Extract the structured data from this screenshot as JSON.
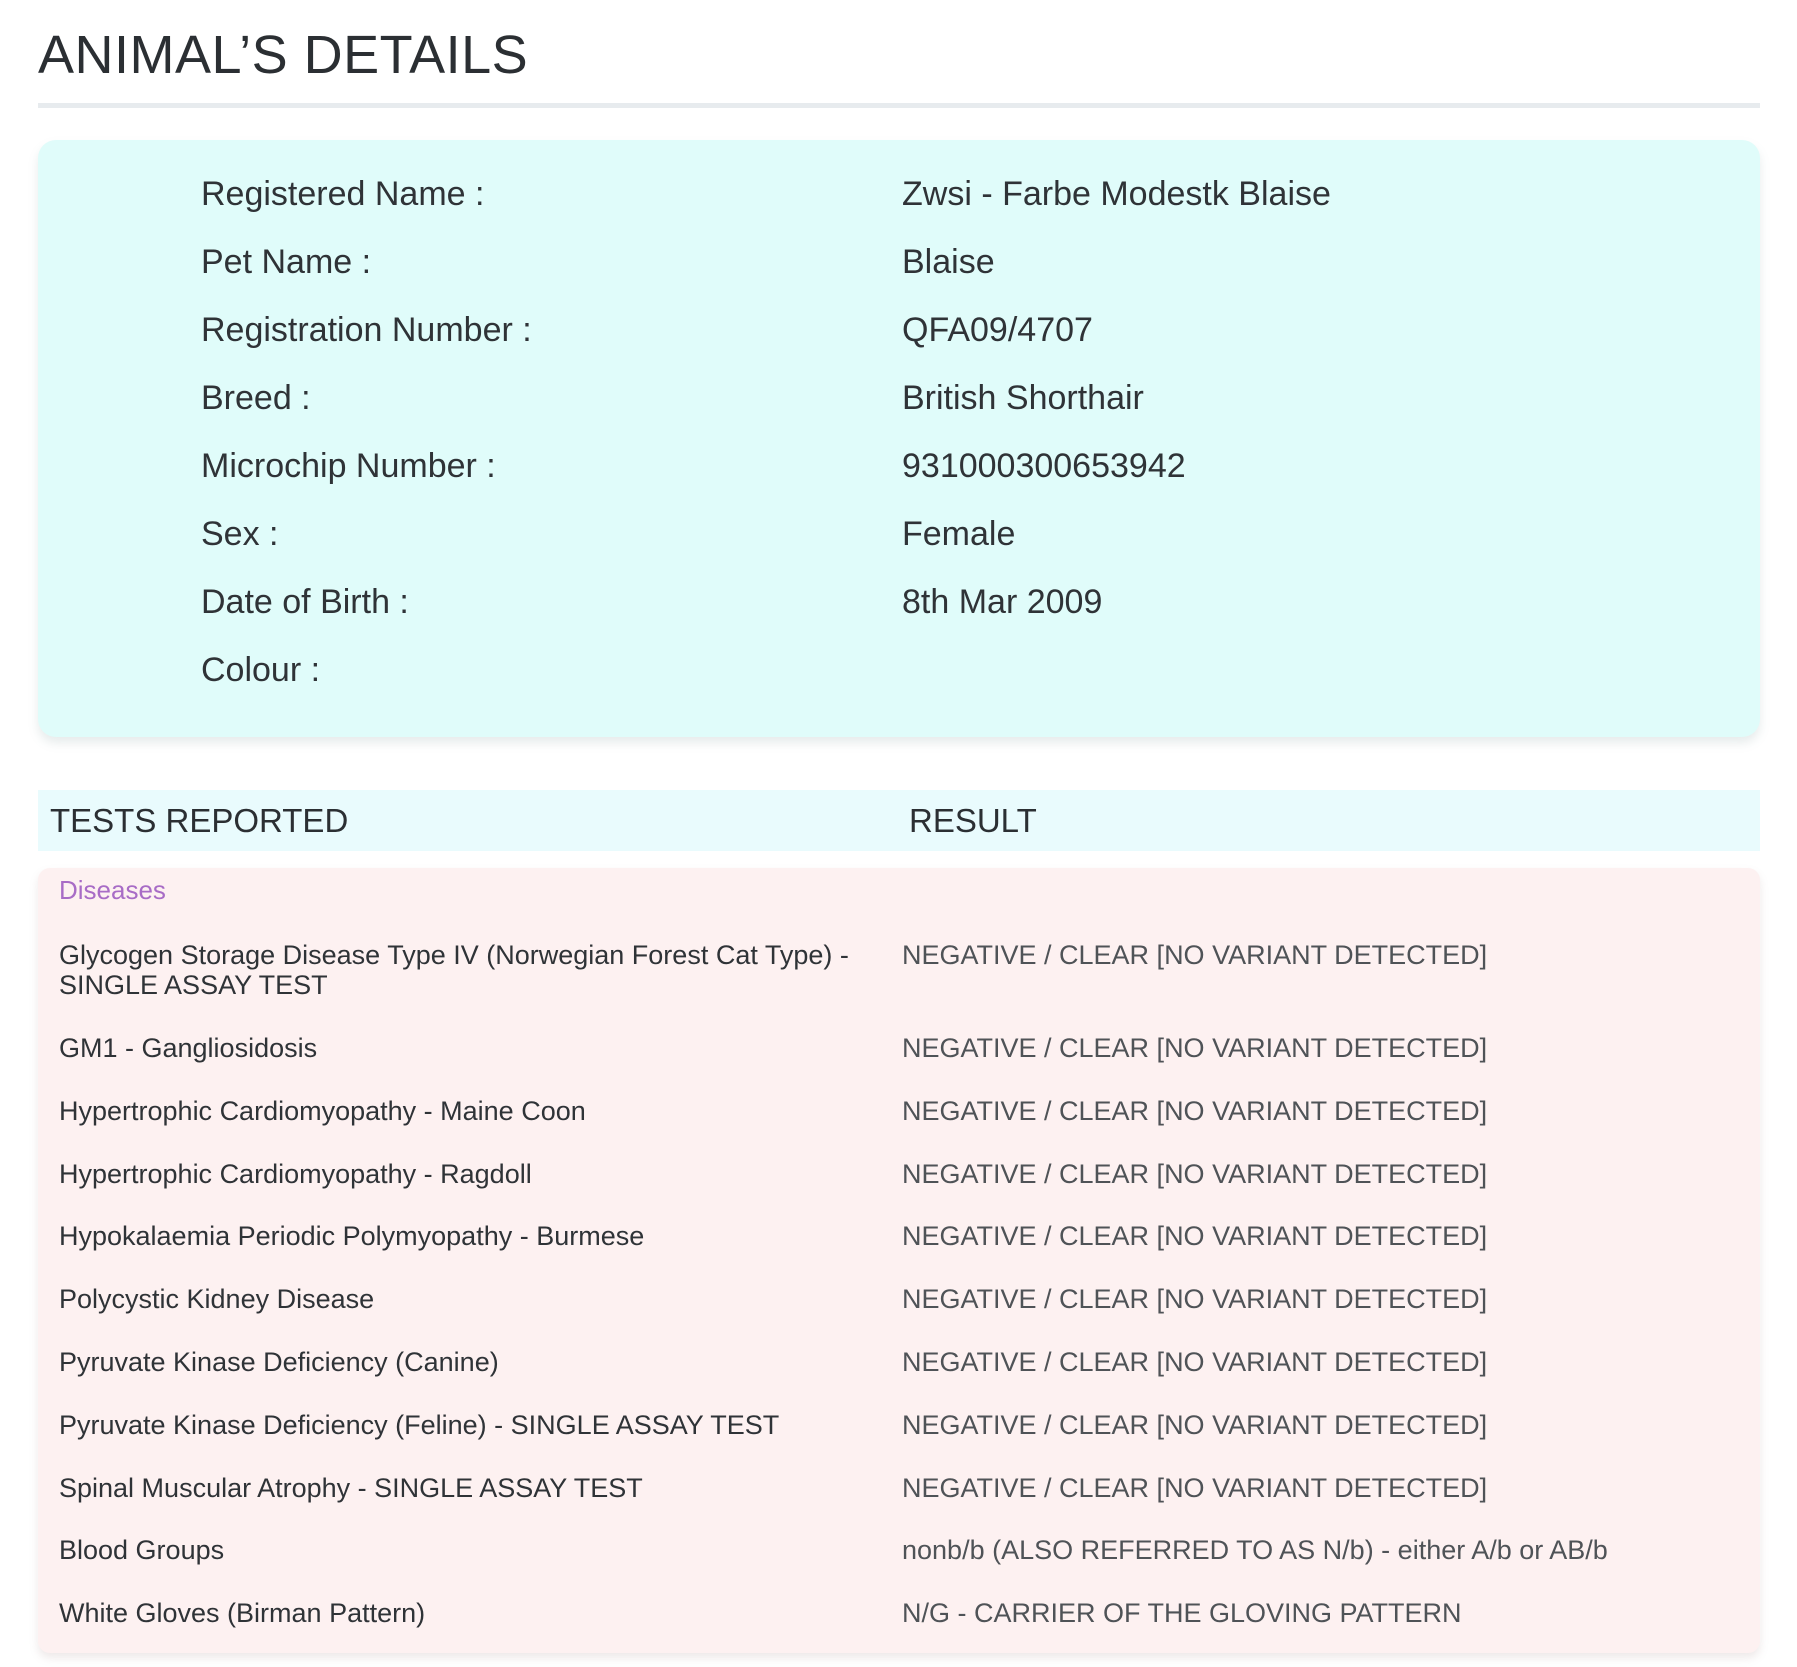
{
  "page": {
    "title": "ANIMAL’S DETAILS"
  },
  "animal_details": [
    {
      "label": "Registered Name :",
      "value": "Zwsi - Farbe Modestk Blaise"
    },
    {
      "label": "Pet Name :",
      "value": "Blaise"
    },
    {
      "label": "Registration Number :",
      "value": "QFA09/4707"
    },
    {
      "label": "Breed :",
      "value": "British Shorthair"
    },
    {
      "label": "Microchip Number :",
      "value": "931000300653942"
    },
    {
      "label": "Sex :",
      "value": "Female"
    },
    {
      "label": "Date of Birth :",
      "value": "8th Mar 2009"
    },
    {
      "label": "Colour :",
      "value": ""
    }
  ],
  "tests_table": {
    "header_test": "TESTS REPORTED",
    "header_result": "RESULT",
    "section_label": "Diseases",
    "rows": [
      {
        "test": "Glycogen Storage Disease Type IV (Norwegian Forest Cat Type) - SINGLE ASSAY TEST",
        "result": "NEGATIVE / CLEAR [NO VARIANT DETECTED]"
      },
      {
        "test": "GM1 - Gangliosidosis",
        "result": "NEGATIVE / CLEAR [NO VARIANT DETECTED]"
      },
      {
        "test": "Hypertrophic Cardiomyopathy - Maine Coon",
        "result": "NEGATIVE / CLEAR [NO VARIANT DETECTED]"
      },
      {
        "test": "Hypertrophic Cardiomyopathy - Ragdoll",
        "result": "NEGATIVE / CLEAR [NO VARIANT DETECTED]"
      },
      {
        "test": "Hypokalaemia Periodic Polymyopathy - Burmese",
        "result": "NEGATIVE / CLEAR [NO VARIANT DETECTED]"
      },
      {
        "test": "Polycystic Kidney Disease",
        "result": "NEGATIVE / CLEAR [NO VARIANT DETECTED]"
      },
      {
        "test": "Pyruvate Kinase Deficiency (Canine)",
        "result": "NEGATIVE / CLEAR [NO VARIANT DETECTED]"
      },
      {
        "test": "Pyruvate Kinase Deficiency (Feline) - SINGLE ASSAY TEST",
        "result": "NEGATIVE / CLEAR [NO VARIANT DETECTED]"
      },
      {
        "test": "Spinal Muscular Atrophy - SINGLE ASSAY TEST",
        "result": "NEGATIVE / CLEAR [NO VARIANT DETECTED]"
      },
      {
        "test": "Blood Groups",
        "result": "nonb/b (ALSO REFERRED TO AS N/b) - either A/b or AB/b"
      },
      {
        "test": "White Gloves (Birman Pattern)",
        "result": "N/G - CARRIER OF THE GLOVING PATTERN"
      }
    ]
  },
  "colors": {
    "details_bg": "#e0fcfa",
    "header_bg": "#e9fbfd",
    "results_bg": "#fdf1f1",
    "section_label": "#a86cc6"
  }
}
